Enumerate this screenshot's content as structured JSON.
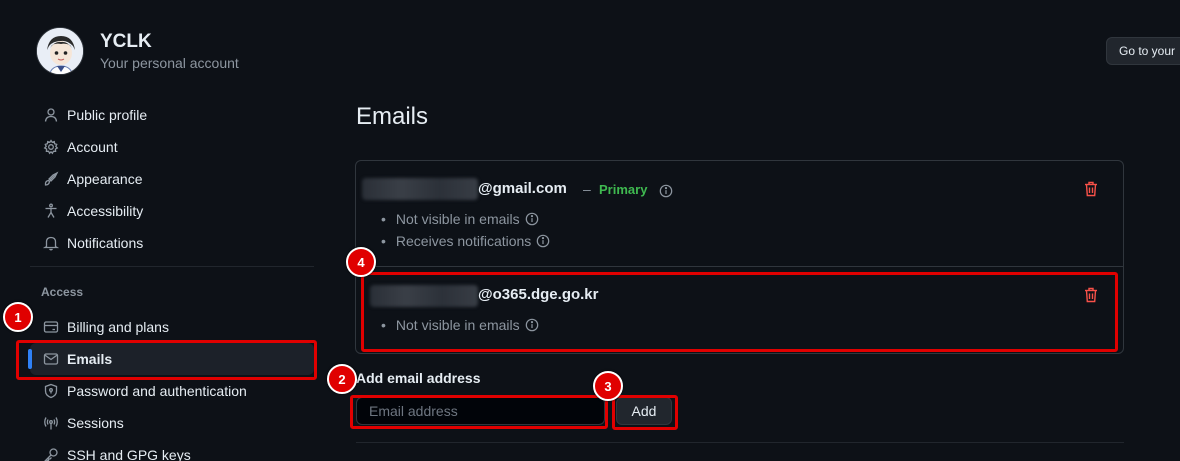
{
  "account": {
    "username": "YCLK",
    "subtitle": "Your personal account",
    "goto_button": "Go to your"
  },
  "sidebar": {
    "items_top": [
      {
        "label": "Public profile",
        "icon": "person-icon"
      },
      {
        "label": "Account",
        "icon": "gear-icon"
      },
      {
        "label": "Appearance",
        "icon": "paintbrush-icon"
      },
      {
        "label": "Accessibility",
        "icon": "accessibility-icon"
      },
      {
        "label": "Notifications",
        "icon": "bell-icon"
      }
    ],
    "group_label": "Access",
    "items_access": [
      {
        "label": "Billing and plans",
        "icon": "credit-card-icon"
      },
      {
        "label": "Emails",
        "icon": "mail-icon",
        "active": true
      },
      {
        "label": "Password and authentication",
        "icon": "shield-lock-icon"
      },
      {
        "label": "Sessions",
        "icon": "broadcast-icon"
      },
      {
        "label": "SSH and GPG keys",
        "icon": "key-icon"
      }
    ]
  },
  "main": {
    "title": "Emails",
    "emails": [
      {
        "domain": "@gmail.com",
        "separator": "–",
        "primary_label": "Primary",
        "bullets": [
          "Not visible in emails",
          "Receives notifications"
        ]
      },
      {
        "domain": "@o365.dge.go.kr",
        "bullets": [
          "Not visible in emails"
        ]
      }
    ],
    "add_label": "Add email address",
    "input_placeholder": "Email address",
    "add_button": "Add"
  },
  "annotations": {
    "badges": [
      "1",
      "2",
      "3",
      "4"
    ],
    "color": "#e00000"
  },
  "colors": {
    "background": "#0d1117",
    "primary_green": "#3fb950",
    "active_indicator": "#2f81f7",
    "danger": "#f85149"
  }
}
